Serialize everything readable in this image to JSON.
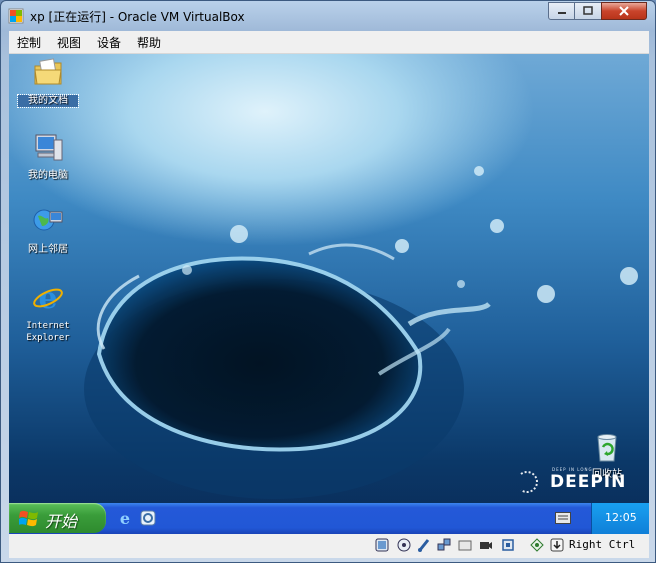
{
  "window": {
    "title": "xp [正在运行] - Oracle VM VirtualBox"
  },
  "menu": [
    "控制",
    "视图",
    "设备",
    "帮助"
  ],
  "desktop": {
    "icons": [
      {
        "label": "我的文档",
        "icon": "my-documents-icon"
      },
      {
        "label": "我的电脑",
        "icon": "my-computer-icon"
      },
      {
        "label": "网上邻居",
        "icon": "network-places-icon"
      },
      {
        "label_line1": "Internet",
        "label_line2": "Explorer",
        "icon": "internet-explorer-icon"
      },
      {
        "label": "回收站",
        "icon": "recycle-bin-icon"
      }
    ],
    "wallpaper_brand": "DEEPIN",
    "wallpaper_tagline": "DEEP IN LONG"
  },
  "taskbar": {
    "start_label": "开始",
    "clock": "12:05"
  },
  "statusbar": {
    "host_key": "Right Ctrl"
  },
  "colors": {
    "taskbar": "#2459d8",
    "start_button": "#3a9d3a",
    "tray": "#0f7fd8"
  }
}
